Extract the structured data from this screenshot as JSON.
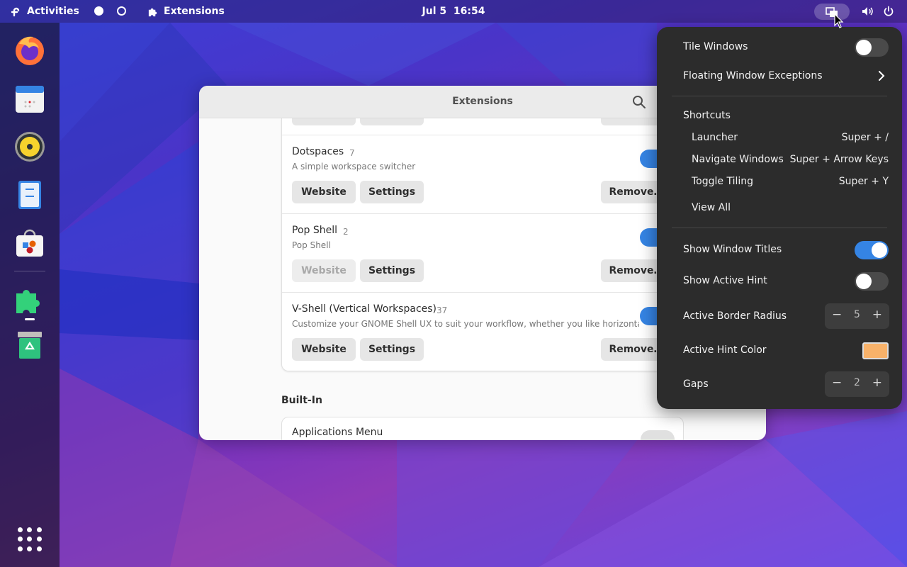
{
  "colors": {
    "accent": "#3584e4",
    "active_hint_color": "#f8b26a"
  },
  "topbar": {
    "activities_label": "Activities",
    "app_indicator_label": "Extensions",
    "clock": "Jul 5  16:54",
    "icons": [
      "fedora-logo-icon",
      "workspace-dot-icon",
      "puzzle-icon",
      "tiling-icon",
      "volume-icon",
      "power-icon"
    ]
  },
  "dock": {
    "apps": [
      "Firefox",
      "Calendar",
      "Rhythmbox",
      "Files",
      "Software",
      "Extensions",
      "Trash"
    ]
  },
  "extensions_window": {
    "title": "Extensions",
    "items": [
      {
        "name": "Dotspaces",
        "count": "7",
        "description": "A simple workspace switcher",
        "website_label": "Website",
        "settings_label": "Settings",
        "remove_label": "Remove…",
        "enabled": true
      },
      {
        "name": "Pop Shell",
        "count": "2",
        "description": "Pop Shell",
        "website_label": "Website",
        "settings_label": "Settings",
        "remove_label": "Remove…",
        "enabled": true
      },
      {
        "name": "V-Shell (Vertical Workspaces)",
        "count": "37",
        "description": "Customize your GNOME Shell UX to suit your workflow, whether you like horizontally or …",
        "website_label": "Website",
        "settings_label": "Settings",
        "remove_label": "Remove…",
        "enabled": true
      }
    ],
    "builtin_heading": "Built-In",
    "builtin_items": [
      {
        "name": "Applications Menu",
        "enabled": false
      }
    ]
  },
  "popup": {
    "tile_windows_label": "Tile Windows",
    "tile_windows_on": false,
    "floating_exceptions_label": "Floating Window Exceptions",
    "shortcuts_heading": "Shortcuts",
    "shortcuts": [
      {
        "label": "Launcher",
        "keys": "Super + /"
      },
      {
        "label": "Navigate Windows",
        "keys": "Super + Arrow Keys"
      },
      {
        "label": "Toggle Tiling",
        "keys": "Super + Y"
      }
    ],
    "view_all_label": "View All",
    "show_window_titles_label": "Show Window Titles",
    "show_window_titles_on": true,
    "show_active_hint_label": "Show Active Hint",
    "show_active_hint_on": false,
    "active_border_radius_label": "Active Border Radius",
    "active_border_radius_value": "5",
    "active_hint_color_label": "Active Hint Color",
    "gaps_label": "Gaps",
    "gaps_value": "2",
    "minus_symbol": "−",
    "plus_symbol": "+"
  }
}
